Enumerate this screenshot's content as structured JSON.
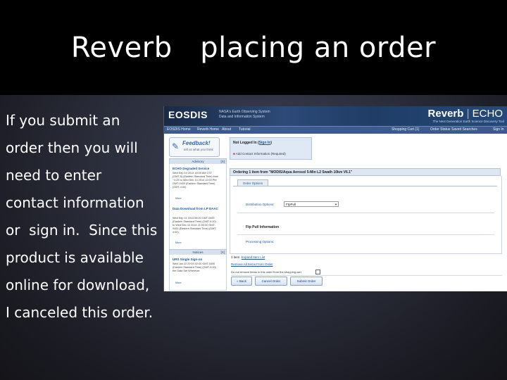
{
  "slide": {
    "title": "Reverb   placing an order",
    "body_lines": [
      "If you submit an",
      "order then you will",
      "need to enter",
      "contact information",
      "or  sign in.  Since this",
      "product is available",
      "online for download,",
      "I canceled this order."
    ]
  },
  "screenshot": {
    "banner": {
      "eosdis": "EOSDIS",
      "eosdis_sub": "NASA's Earth Observing System Data and Information System",
      "reverb": "Reverb",
      "separator": "|",
      "echo": "ECHO",
      "reverb_sub": "The Next Generation Earth Science Discovery Tool"
    },
    "nav": {
      "items": [
        "EOSDIS Home",
        "Reverb Home",
        "About",
        "Tutorial"
      ],
      "right_items": [
        "Shopping Cart (1)",
        "Order Status",
        "Saved Searches",
        "Sign In"
      ]
    },
    "feedback": {
      "title": "Feedback!",
      "sub": "tell us what you think"
    },
    "left_panels": {
      "first_head": "Advisory",
      "first_items": [
        {
          "title": "ECHO Degraded Service",
          "text": "Wed Sep 10 2014 18:00 AM CST (GMT-5) (Eastern Standard Time) from ~4:25 to Wed Dec 10 2014 12:00 PM GMT-0400 (Eastern Standard Time) (GMT-4:00)",
          "more": "More"
        },
        {
          "title": "Data Download from LP DAAC",
          "text": "Wed Sep 11 2014 08:00 GMT-0400 (Eastern Standard Time) (GMT-4:00) to Wed Dec 10 2014 21:00:00 GMT-0400 (Eastern Standard Time) (GMT-4:00)",
          "more": "More"
        }
      ],
      "second_head": "Notices",
      "second_items": [
        {
          "title": "URS Single Sign-on",
          "text": "Wed Jan 22 20:14 02:00 GMT-0400 (Eastern Standard Time) (GMT-4:00) the Data Set Wherever",
          "more": "More"
        }
      ],
      "close": "[X]"
    },
    "login": {
      "not_logged": "Not Logged In (",
      "sign_in": "Sign In",
      "closing": ")",
      "contact": "Add Contact Information (Required)"
    },
    "order": {
      "header": "Ordering 1 item from \"MODIS/Aqua Aerosol 5-Min L2 Swath 10km V6.1\"",
      "tab": "Order Options",
      "dist_label": "Distribution Options:",
      "dist_value": "FtpPull",
      "ftp_title": "Ftp Pull Information",
      "proc_label": "Processing Options:",
      "item_prefix": "1 item:",
      "item_link": "Expand Item List",
      "remove_all": "Remove All Items From Order",
      "not_remove": "Do not remove items in this order from the shopping cart"
    },
    "buttons": {
      "back": "« Back",
      "cancel": "Cancel Order",
      "submit": "Submit Order"
    }
  }
}
